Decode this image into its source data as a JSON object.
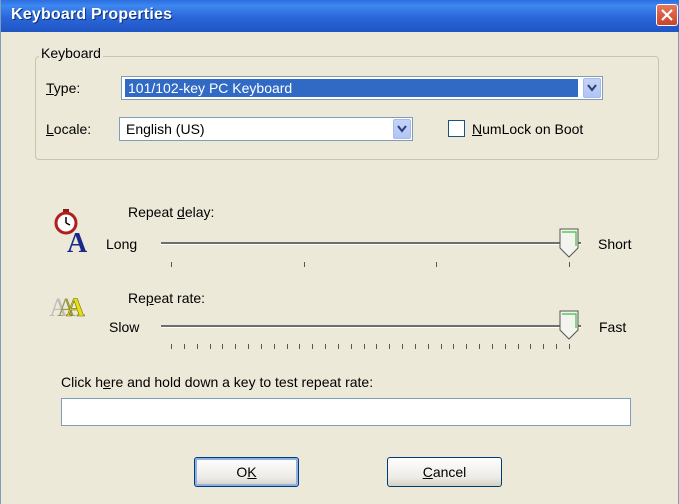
{
  "window": {
    "title": "Keyboard Properties"
  },
  "keyboard_group": {
    "legend": "Keyboard",
    "type_label_pre": "",
    "type_label_u": "T",
    "type_label_post": "ype:",
    "type_value": "101/102-key PC Keyboard",
    "locale_label_u": "L",
    "locale_label_post": "ocale:",
    "locale_value": "English (US)",
    "numlock_u": "N",
    "numlock_post": "umLock on Boot",
    "numlock_checked": false
  },
  "repeat_delay": {
    "label_pre": "Repeat ",
    "label_u": "d",
    "label_post": "elay:",
    "min_label": "Long",
    "max_label": "Short",
    "level": 1.0,
    "tick_count": 4
  },
  "repeat_rate": {
    "label_pre": "Re",
    "label_u": "p",
    "label_post": "eat rate:",
    "min_label": "Slow",
    "max_label": "Fast",
    "level": 1.0,
    "tick_count": 32
  },
  "test_area": {
    "label_pre": "Click h",
    "label_u": "e",
    "label_post": "re and hold down a key to test repeat rate:",
    "value": ""
  },
  "buttons": {
    "ok_pre": "O",
    "ok_u": "K",
    "cancel_u": "C",
    "cancel_post": "ancel"
  },
  "colors": {
    "title_bar": "#2a66d8",
    "selection": "#316ac5",
    "dialog_bg": "#ece9d8"
  }
}
